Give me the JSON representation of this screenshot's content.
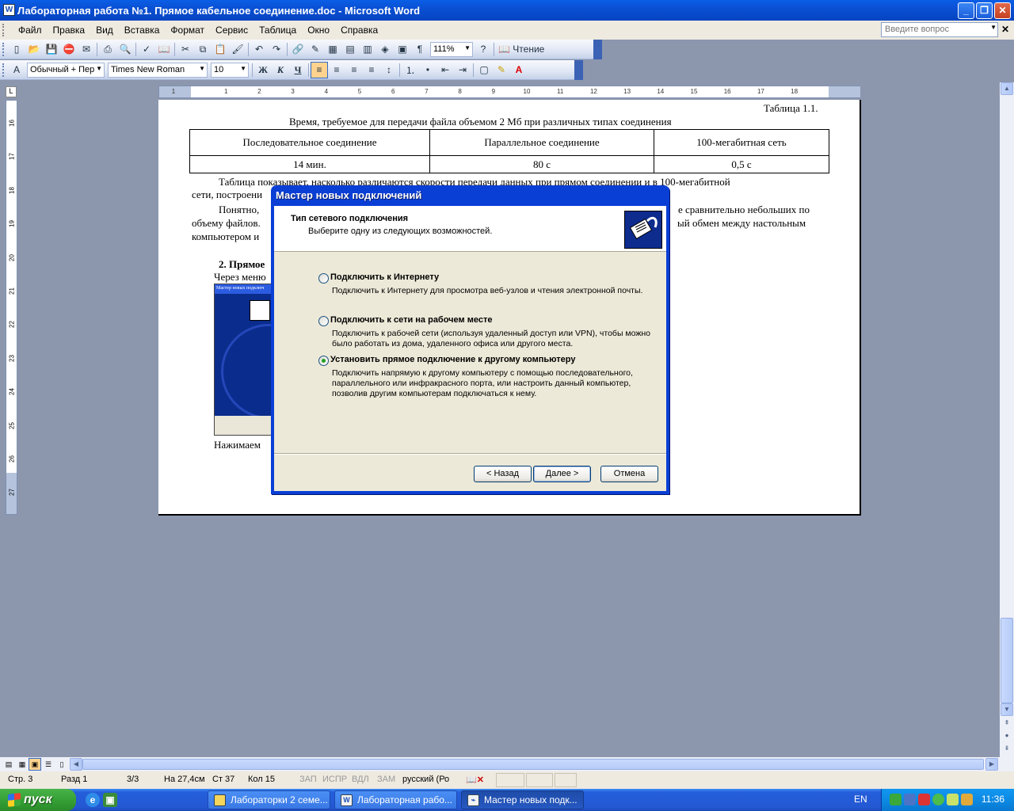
{
  "window": {
    "title": "Лабораторная работа №1. Прямое кабельное соединение.doc - Microsoft Word",
    "app_icon_letter": "W",
    "controls": {
      "minimize": "_",
      "restore": "❐",
      "close": "✕"
    }
  },
  "menu": {
    "items": [
      "Файл",
      "Правка",
      "Вид",
      "Вставка",
      "Формат",
      "Сервис",
      "Таблица",
      "Окно",
      "Справка"
    ],
    "help_placeholder": "Введите вопрос"
  },
  "toolbar_standard": {
    "zoom": "111%",
    "reading_label": "Чтение"
  },
  "toolbar_formatting": {
    "style": "Обычный + Пер",
    "font": "Times New Roman",
    "size": "10",
    "bold": "Ж",
    "italic": "К",
    "underline": "Ч"
  },
  "ruler": {
    "h_numbers": [
      "1",
      "1",
      "2",
      "3",
      "4",
      "5",
      "6",
      "7",
      "8",
      "9",
      "10",
      "11",
      "12",
      "13",
      "14",
      "15",
      "16",
      "17",
      "18"
    ],
    "v_numbers": [
      "16",
      "17",
      "18",
      "19",
      "20",
      "21",
      "22",
      "23",
      "24",
      "25",
      "26",
      "27"
    ]
  },
  "document": {
    "table_caption": "Таблица 1.1.",
    "table_title": "Время, требуемое для передачи файла объемом 2 Мб  при различных типах соединения",
    "table_headers": [
      "Последовательное соединение",
      "Параллельное соединение",
      "100-мегабитная сеть"
    ],
    "table_values": [
      "14 мин.",
      "80 с",
      "0,5 с"
    ],
    "para1_line1": "Таблица показывает, насколько различаются скорости передачи данных при прямом соединении и в 100-мегабитной",
    "para1_line2": "сети, построени",
    "para2_line1_left": "Понятно,",
    "para2_line1_right": "е сравнительно небольших по",
    "para2_line2_left": "объему файлов.",
    "para2_line2_right": "ый обмен между настольным",
    "para2_line3_left": "компьютером и",
    "heading2": "2. Прямое",
    "line_through": "Через меню",
    "thumb_title": "Мастер новых подключ",
    "line_press": "Нажимаем"
  },
  "dialog": {
    "title": "Мастер новых подключений",
    "header_title": "Тип сетевого подключения",
    "header_subtitle": "Выберите одну из следующих возможностей.",
    "options": [
      {
        "label": "Подключить к Интернету",
        "desc": "Подключить к Интернету для просмотра веб-узлов и чтения  электронной почты.",
        "checked": false
      },
      {
        "label": "Подключить к сети на рабочем месте",
        "desc": "Подключить к рабочей сети (используя удаленный доступ или VPN), чтобы можно было работать из дома, удаленного офиса или другого места.",
        "checked": false
      },
      {
        "label": "Установить прямое подключение к другому компьютеру",
        "desc": "Подключить напрямую к другому компьютеру с помощью последовательного, параллельного или инфракрасного порта, или настроить данный компьютер, позволив другим  компьютерам подключаться к нему.",
        "checked": true
      }
    ],
    "back": "< Назад",
    "next": "Далее >",
    "cancel": "Отмена"
  },
  "status": {
    "page": "Стр. 3",
    "section": "Разд 1",
    "pages": "3/3",
    "at": "На 27,4см",
    "line": "Ст 37",
    "col": "Кол 15",
    "rec": "ЗАП",
    "trk": "ИСПР",
    "ext": "ВДЛ",
    "ovr": "ЗАМ",
    "lang": "русский (Ро"
  },
  "taskbar": {
    "start": "пуск",
    "tasks": [
      {
        "label": "Лабораторки 2 семе...",
        "active": false
      },
      {
        "label": "Лабораторная рабо...",
        "active": false
      },
      {
        "label": "Мастер новых подк...",
        "active": true
      }
    ],
    "lang": "EN",
    "clock": "11:36"
  }
}
